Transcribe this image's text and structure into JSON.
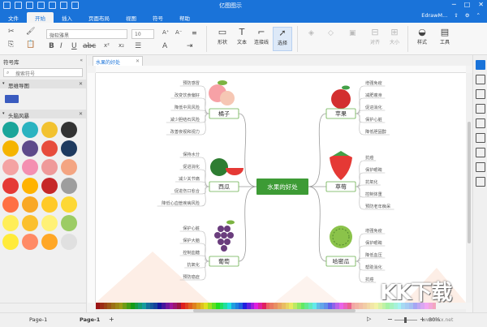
{
  "app": {
    "title": "亿图图示",
    "menu": [
      "文件",
      "开始",
      "插入",
      "页面布局",
      "视图",
      "符号",
      "帮助"
    ],
    "active_menu": "开始",
    "user": "EdrawM..."
  },
  "ribbon": {
    "font_name": "微软雅黑",
    "font_size": "10",
    "tools": {
      "shape": "形状",
      "text": "文本",
      "connector": "连接线",
      "select": "选择",
      "arrange": "对齐",
      "size": "大小",
      "style": "样式",
      "tools": "工具"
    }
  },
  "left_panel": {
    "title": "符号库",
    "search_placeholder": "搜索符号",
    "categories": [
      "思维导图",
      "头脑风暴"
    ]
  },
  "document": {
    "tab_name": "水果的好处"
  },
  "mindmap": {
    "center": "水果的好处",
    "branches": [
      {
        "label": "橘子",
        "items": [
          "预防感冒",
          "改变饮食偏好",
          "降低中风风险",
          "减少胆结石风险",
          "改善夜视和视力"
        ]
      },
      {
        "label": "西瓜",
        "items": [
          "保持水分",
          "促进消化",
          "减少关节痛",
          "促进伤口愈合",
          "降低心血管疾病风险"
        ]
      },
      {
        "label": "葡萄",
        "items": [
          "保护心脏",
          "保护大脑",
          "控制血糖",
          "抗氧化",
          "预防癌症"
        ]
      },
      {
        "label": "苹果",
        "items": [
          "增强免疫",
          "减肥瘦身",
          "促进消化",
          "保护心脏",
          "降低胆固醇"
        ]
      },
      {
        "label": "草莓",
        "items": [
          "抗癌",
          "保护眼睛",
          "抗氧化",
          "控制体重",
          "预防老年痴呆"
        ]
      },
      {
        "label": "哈密瓜",
        "items": [
          "增强免疫",
          "保护眼睛",
          "降低血压",
          "帮助消化",
          "抗癌"
        ]
      }
    ]
  },
  "status": {
    "page_dropdown": "Page-1",
    "page_tab": "Page-1",
    "zoom": "80%"
  },
  "watermark": {
    "brand": "KK下载",
    "site": "www.kkx.net"
  },
  "colors": {
    "accent": "#1a73d9",
    "branch_border": "#6ab04c",
    "center_fill": "#3d9b35"
  }
}
